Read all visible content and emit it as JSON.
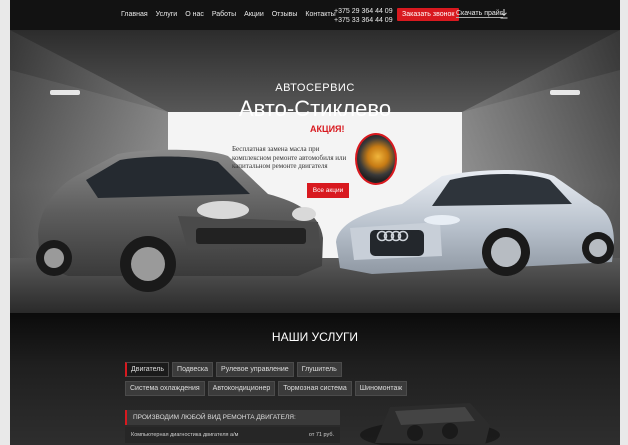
{
  "nav": {
    "items": [
      "Главная",
      "Услуги",
      "О нас",
      "Работы",
      "Акции",
      "Отзывы",
      "Контакты"
    ],
    "phones": [
      "+375 29 364 44 09",
      "+375 33 364 44 09"
    ],
    "order_call": "Заказать звонок",
    "download_price": "Скачать прайс"
  },
  "hero": {
    "subtitle": "АВТОСЕРВИС",
    "title": "Авто-Стиклево"
  },
  "promo": {
    "title": "АКЦИЯ!",
    "text": "Бесплатная замена масла при комплексном ремонте автомобиля или капитальном ремонте двигателя",
    "button": "Все акции"
  },
  "services": {
    "title": "НАШИ УСЛУГИ",
    "tabs": [
      "Двигатель",
      "Подвеска",
      "Рулевое управление",
      "Глушитель",
      "Система охлаждения",
      "Автокондиционер",
      "Тормозная система",
      "Шиномонтаж"
    ],
    "active_tab": "Двигатель",
    "section_header": "ПРОИЗВОДИМ ЛЮБОЙ ВИД РЕМОНТА ДВИГАТЕЛЯ:",
    "rows": [
      {
        "name": "Компьютерная диагностика двигателя а/м",
        "price": "от 71 руб."
      }
    ]
  },
  "colors": {
    "accent": "#d8191f",
    "header_bg": "#121212"
  }
}
